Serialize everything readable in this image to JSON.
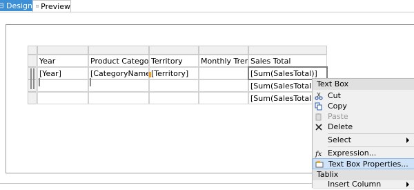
{
  "tabs": [
    {
      "label": "Design",
      "icon": "design-icon"
    },
    {
      "label": "Preview",
      "icon": "preview-icon"
    }
  ],
  "tablix": {
    "headers": [
      "Year",
      "Product Category",
      "Territory",
      "Monthly Trend",
      "Sales Total"
    ],
    "row1": [
      "[Year]",
      "[CategoryName]",
      "[Territory]",
      "",
      "[Sum(SalesTotal)]"
    ],
    "row2": [
      "",
      "",
      "",
      "",
      "[Sum(SalesTotal)]"
    ],
    "row3": [
      "",
      "",
      "",
      "",
      "[Sum(SalesTotal)]"
    ]
  },
  "context_menu": {
    "section_textbox": "Text Box",
    "cut": "Cut",
    "copy": "Copy",
    "paste": "Paste",
    "delete": "Delete",
    "select": "Select",
    "expression": "Expression...",
    "textbox_properties": "Text Box Properties...",
    "section_tablix": "Tablix",
    "insert_column": "Insert Column"
  },
  "colors": {
    "design_tab_bg": "#3d8fd6",
    "menu_highlight": "#cfe3f8",
    "group_marker": "#f0a020"
  }
}
